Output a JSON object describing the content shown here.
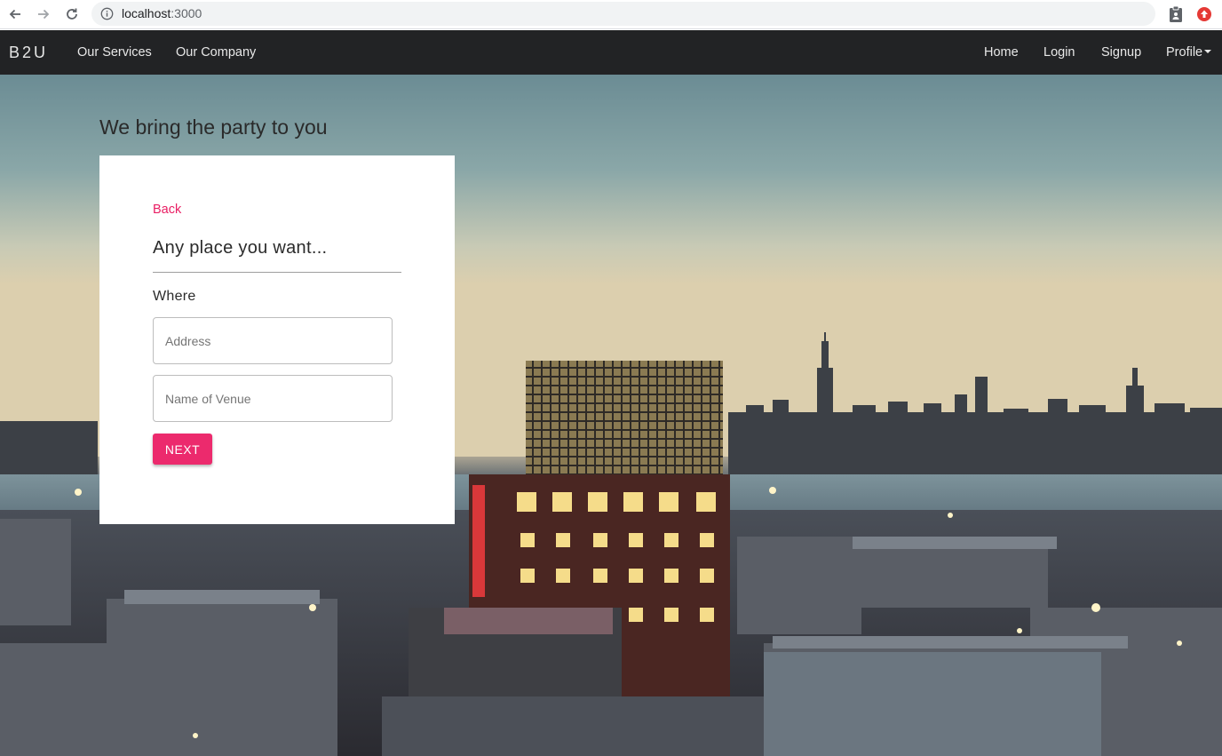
{
  "browser": {
    "url_host": "localhost",
    "url_port": ":3000",
    "icons": [
      "back-arrow-icon",
      "forward-arrow-icon",
      "reload-icon",
      "info-icon",
      "clipboard-extension-icon",
      "red-extension-icon"
    ]
  },
  "navbar": {
    "brand": "B2U",
    "left_links": [
      "Our Services",
      "Our Company"
    ],
    "right_links": [
      "Home",
      "Login",
      "Signup"
    ],
    "profile_label": "Profile"
  },
  "hero": {
    "tagline": "We bring the party to you"
  },
  "card": {
    "back_label": "Back",
    "title": "Any place you want...",
    "where_label": "Where",
    "address_placeholder": "Address",
    "venue_placeholder": "Name of Venue",
    "next_label": "NEXT"
  },
  "colors": {
    "accent": "#e91e63",
    "button": "#ec2a6d",
    "navbar": "#222325"
  }
}
